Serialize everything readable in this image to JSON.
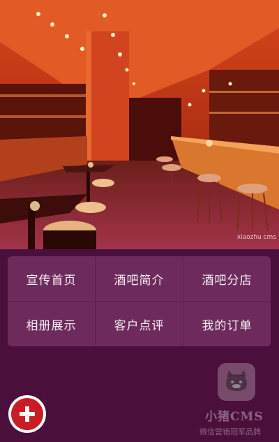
{
  "hero": {
    "image_alt": "",
    "watermark": "xiaozhu cms"
  },
  "menu": {
    "items": [
      {
        "label": "宣传首页"
      },
      {
        "label": "酒吧简介"
      },
      {
        "label": "酒吧分店"
      },
      {
        "label": "相册展示"
      },
      {
        "label": "客户点评"
      },
      {
        "label": "我的订单"
      }
    ]
  },
  "fab": {
    "icon": "plus-icon"
  },
  "brand": {
    "name": "小猪CMS",
    "slogan": "微信营销冠军品牌",
    "icon": "pig-logo-icon"
  },
  "colors": {
    "background": "#4b0f3c",
    "tile": "#6d2b5c",
    "fab": "#c91d24"
  }
}
